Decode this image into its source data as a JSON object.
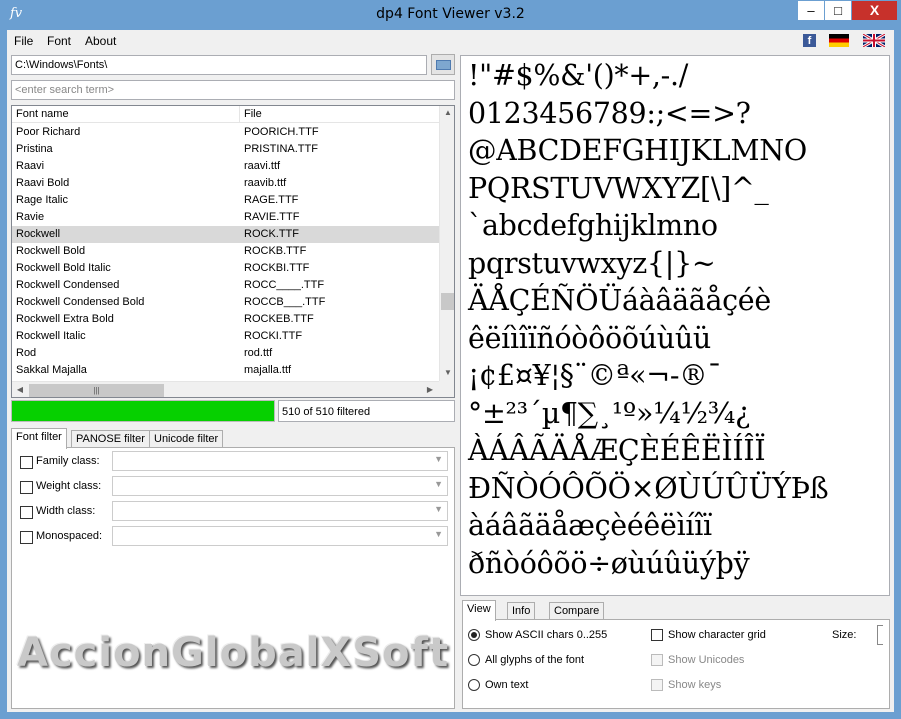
{
  "window": {
    "title": "dp4 Font Viewer v3.2",
    "icon_text": "fv",
    "minimize": "–",
    "maximize": "□",
    "close": "X"
  },
  "menu": {
    "file": "File",
    "font": "Font",
    "about": "About"
  },
  "header_icons": [
    "facebook-icon",
    "german-flag-icon",
    "uk-flag-icon"
  ],
  "path": "C:\\Windows\\Fonts\\",
  "search": {
    "placeholder": "<enter search term>"
  },
  "list": {
    "columns": [
      "Font name",
      "File"
    ],
    "rows": [
      [
        "Poor Richard",
        "POORICH.TTF"
      ],
      [
        "Pristina",
        "PRISTINA.TTF"
      ],
      [
        "Raavi",
        "raavi.ttf"
      ],
      [
        "Raavi Bold",
        "raavib.ttf"
      ],
      [
        "Rage Italic",
        "RAGE.TTF"
      ],
      [
        "Ravie",
        "RAVIE.TTF"
      ],
      [
        "Rockwell",
        "ROCK.TTF"
      ],
      [
        "Rockwell Bold",
        "ROCKB.TTF"
      ],
      [
        "Rockwell Bold Italic",
        "ROCKBI.TTF"
      ],
      [
        "Rockwell Condensed",
        "ROCC____.TTF"
      ],
      [
        "Rockwell Condensed Bold",
        "ROCCB___.TTF"
      ],
      [
        "Rockwell Extra Bold",
        "ROCKEB.TTF"
      ],
      [
        "Rockwell Italic",
        "ROCKI.TTF"
      ],
      [
        "Rod",
        "rod.ttf"
      ],
      [
        "Sakkal Majalla",
        "majalla.ttf"
      ]
    ],
    "selected_index": 6
  },
  "progress": {
    "value": 1.0,
    "color": "#06d000"
  },
  "count_text": "510 of 510 filtered",
  "filter_tabs": [
    "Font filter",
    "PANOSE filter",
    "Unicode filter"
  ],
  "filters": [
    "Family class:",
    "Weight class:",
    "Width class:",
    "Monospaced:"
  ],
  "watermark": "AccionGlobalXSoft",
  "preview_lines": [
    "!\"#$%&'()*+,-./",
    "0123456789:;<=>?",
    "@ABCDEFGHIJKLMNO",
    "PQRSTUVWXYZ[\\]^_",
    "`abcdefghijklmno",
    "pqrstuvwxyz{|}~",
    "ÄÅÇÉÑÖÜáàâäãåçéè",
    "êëíìîïñóòôöõúùûü",
    " ¡¢£¤¥¦§¨©ª«¬-®¯",
    "°±²³´µ¶∑¸¹º»¼½¾¿",
    "ÀÁÂÃÄÅÆÇÈÉÊËÌÍÎÏ",
    "ÐÑÒÓÔÕÖ×ØÙÚÛÜÝÞß",
    "àáâãäåæçèéêëìíîï",
    "ðñòóôõö÷øùúûüýþÿ"
  ],
  "view_tabs": [
    "View",
    "Info",
    "Compare"
  ],
  "view_options": {
    "radios": [
      "Show ASCII chars 0..255",
      "All glyphs of the font",
      "Own text"
    ],
    "checks": [
      "Show character grid",
      "Show Unicodes",
      "Show keys"
    ],
    "size_label": "Size:"
  }
}
